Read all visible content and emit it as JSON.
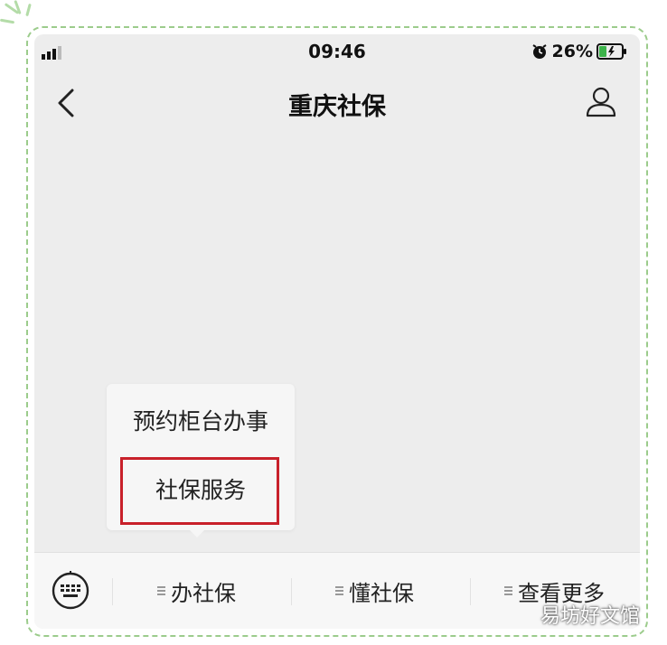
{
  "status_bar": {
    "time": "09:46",
    "battery_percent": "26%"
  },
  "header": {
    "title": "重庆社保"
  },
  "popup_menu": {
    "items": [
      {
        "label": "预约柜台办事"
      },
      {
        "label": "社保服务"
      }
    ],
    "highlighted_index": 1,
    "highlight_color": "#c8202a"
  },
  "bottom_menu": {
    "items": [
      {
        "label": "办社保"
      },
      {
        "label": "懂社保"
      },
      {
        "label": "查看更多"
      }
    ]
  },
  "watermark": "易坊好文馆",
  "colors": {
    "frame_dash": "#9ccc8c",
    "background": "#ededed",
    "battery_green": "#3cb34a"
  },
  "icons": [
    "signal-icon",
    "alarm-icon",
    "battery-icon",
    "back-arrow-icon",
    "user-profile-icon",
    "keyboard-icon"
  ]
}
